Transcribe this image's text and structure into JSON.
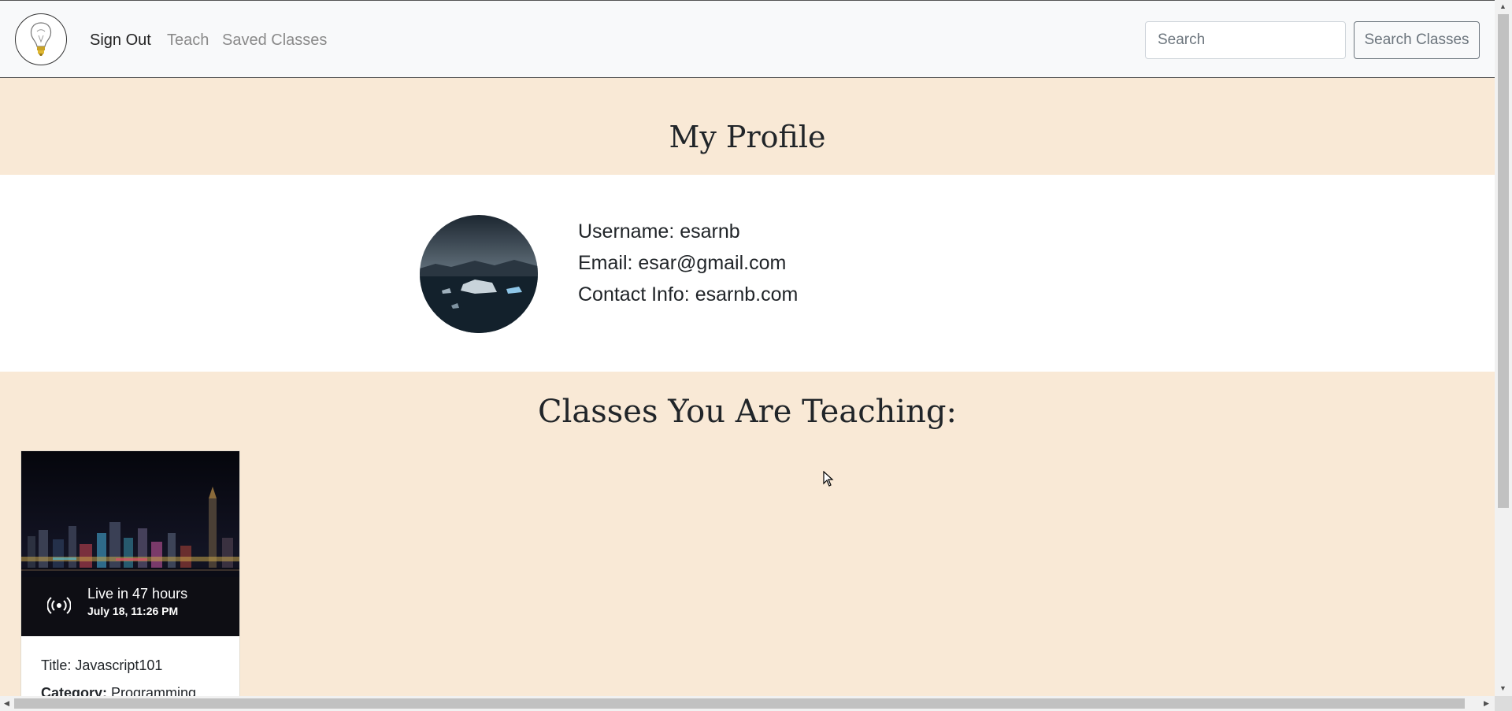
{
  "nav": {
    "sign_out": "Sign Out",
    "teach": "Teach",
    "saved_classes": "Saved Classes",
    "search_placeholder": "Search",
    "search_button": "Search Classes"
  },
  "profile": {
    "title": "My Profile",
    "username_line": "Username: esarnb",
    "email_line": "Email: esar@gmail.com",
    "contact_line": "Contact Info: esarnb.com"
  },
  "teaching": {
    "heading": "Classes You Are Teaching:",
    "classes": [
      {
        "live_text": "Live in 47 hours",
        "live_date": "July 18, 11:26 PM",
        "title_line": "Title: Javascript101",
        "category_label": "Category:",
        "category_value": " Programming"
      }
    ]
  },
  "colors": {
    "page_background": "#f9e9d6",
    "navbar_background": "#f8f9fa",
    "profile_band": "#ffffff"
  },
  "icons": [
    "lightbulb-logo-icon",
    "broadcast-icon",
    "mouse-cursor-icon"
  ]
}
